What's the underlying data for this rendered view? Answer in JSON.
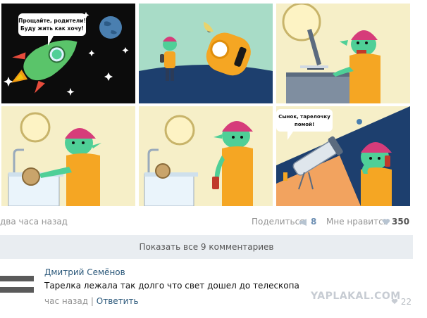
{
  "comic": {
    "panel1_bubble_line1": "Прощайте, родители!",
    "panel1_bubble_line2": "Буду жить как хочу!",
    "panel6_bubble_line1": "Сынок, тарелочку",
    "panel6_bubble_line2": "помой!"
  },
  "post": {
    "time_ago": "два часа назад",
    "share_label": "Поделиться",
    "share_count": "8",
    "like_label": "Мне нравится",
    "like_count": "350"
  },
  "show_comments_label": "Показать все 9 комментариев",
  "comment": {
    "author": "Дмитрий Семёнов",
    "text": "Тарелка лежала так долго что свет дошел до телескопа",
    "time": "час назад",
    "separator": "|",
    "reply_label": "Ответить",
    "like_count": "22"
  },
  "watermark": "YAPLAKAL.COM",
  "colors": {
    "link": "#2b587a",
    "alien_skin": "#4fcf97",
    "alien_hair": "#d63c7a",
    "suit": "#f5a623",
    "panel_bg": "#f6efc8"
  }
}
